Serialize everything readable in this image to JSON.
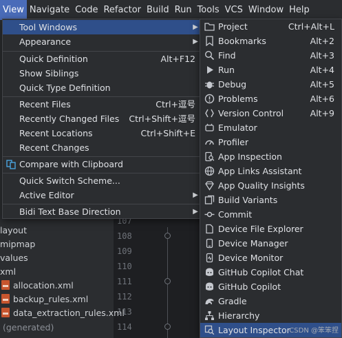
{
  "menubar": {
    "items": [
      "View",
      "Navigate",
      "Code",
      "Refactor",
      "Build",
      "Run",
      "Tools",
      "VCS",
      "Window",
      "Help"
    ]
  },
  "tree": {
    "items": [
      "layout",
      "mipmap",
      "values",
      "xml",
      "allocation.xml",
      "backup_rules.xml",
      "data_extraction_rules.xml",
      "(generated)"
    ]
  },
  "gutter": {
    "line_numbers": [
      "107",
      "108",
      "109",
      "110",
      "111",
      "112",
      "113",
      "114"
    ]
  },
  "view_menu": {
    "items": [
      {
        "label": "Tool Windows",
        "shortcut": "",
        "submenu": true
      },
      {
        "label": "Appearance",
        "shortcut": "",
        "submenu": true
      },
      {
        "label": "Quick Definition",
        "shortcut": "Alt+F12"
      },
      {
        "label": "Show Siblings",
        "shortcut": ""
      },
      {
        "label": "Quick Type Definition",
        "shortcut": ""
      },
      {
        "label": "Recent Files",
        "shortcut": "Ctrl+逗号"
      },
      {
        "label": "Recently Changed Files",
        "shortcut": "Ctrl+Shift+逗号"
      },
      {
        "label": "Recent Locations",
        "shortcut": "Ctrl+Shift+E"
      },
      {
        "label": "Recent Changes",
        "shortcut": ""
      },
      {
        "label": "Compare with Clipboard",
        "shortcut": ""
      },
      {
        "label": "Quick Switch Scheme...",
        "shortcut": ""
      },
      {
        "label": "Active Editor",
        "shortcut": "",
        "submenu": true
      },
      {
        "label": "Bidi Text Base Direction",
        "shortcut": "",
        "submenu": true
      }
    ]
  },
  "tool_windows_menu": {
    "items": [
      {
        "label": "Project",
        "shortcut": "Ctrl+Alt+L",
        "icon": "folder-icon"
      },
      {
        "label": "Bookmarks",
        "shortcut": "Alt+2",
        "icon": "bookmark-icon"
      },
      {
        "label": "Find",
        "shortcut": "Alt+3",
        "icon": "search-icon"
      },
      {
        "label": "Run",
        "shortcut": "Alt+4",
        "icon": "play-icon"
      },
      {
        "label": "Debug",
        "shortcut": "Alt+5",
        "icon": "bug-icon"
      },
      {
        "label": "Problems",
        "shortcut": "Alt+6",
        "icon": "warning-icon"
      },
      {
        "label": "Version Control",
        "shortcut": "Alt+9",
        "icon": "branch-icon"
      },
      {
        "label": "Emulator",
        "shortcut": "",
        "icon": "device-icon"
      },
      {
        "label": "Profiler",
        "shortcut": "",
        "icon": "gauge-icon"
      },
      {
        "label": "App Inspection",
        "shortcut": "",
        "icon": "inspect-icon"
      },
      {
        "label": "App Links Assistant",
        "shortcut": "",
        "icon": "link-icon"
      },
      {
        "label": "App Quality Insights",
        "shortcut": "",
        "icon": "diamond-icon"
      },
      {
        "label": "Build Variants",
        "shortcut": "",
        "icon": "variants-icon"
      },
      {
        "label": "Commit",
        "shortcut": "",
        "icon": "commit-icon"
      },
      {
        "label": "Device File Explorer",
        "shortcut": "",
        "icon": "file-icon"
      },
      {
        "label": "Device Manager",
        "shortcut": "",
        "icon": "device-manager-icon"
      },
      {
        "label": "Device Monitor",
        "shortcut": "",
        "icon": "monitor-icon"
      },
      {
        "label": "GitHub Copilot Chat",
        "shortcut": "",
        "icon": "copilot-chat-icon"
      },
      {
        "label": "GitHub Copilot",
        "shortcut": "",
        "icon": "copilot-icon"
      },
      {
        "label": "Gradle",
        "shortcut": "",
        "icon": "gradle-icon"
      },
      {
        "label": "Hierarchy",
        "shortcut": "",
        "icon": "hierarchy-icon"
      },
      {
        "label": "Layout Inspector",
        "shortcut": "",
        "icon": "layout-inspector-icon"
      }
    ]
  },
  "watermark": "CSDN @笨笨捏",
  "colors": {
    "active_menu": "#4a6cb9",
    "highlight": "#2f4f8a",
    "menu_bg": "#2b2d30",
    "xml_icon": "#c7552e"
  }
}
